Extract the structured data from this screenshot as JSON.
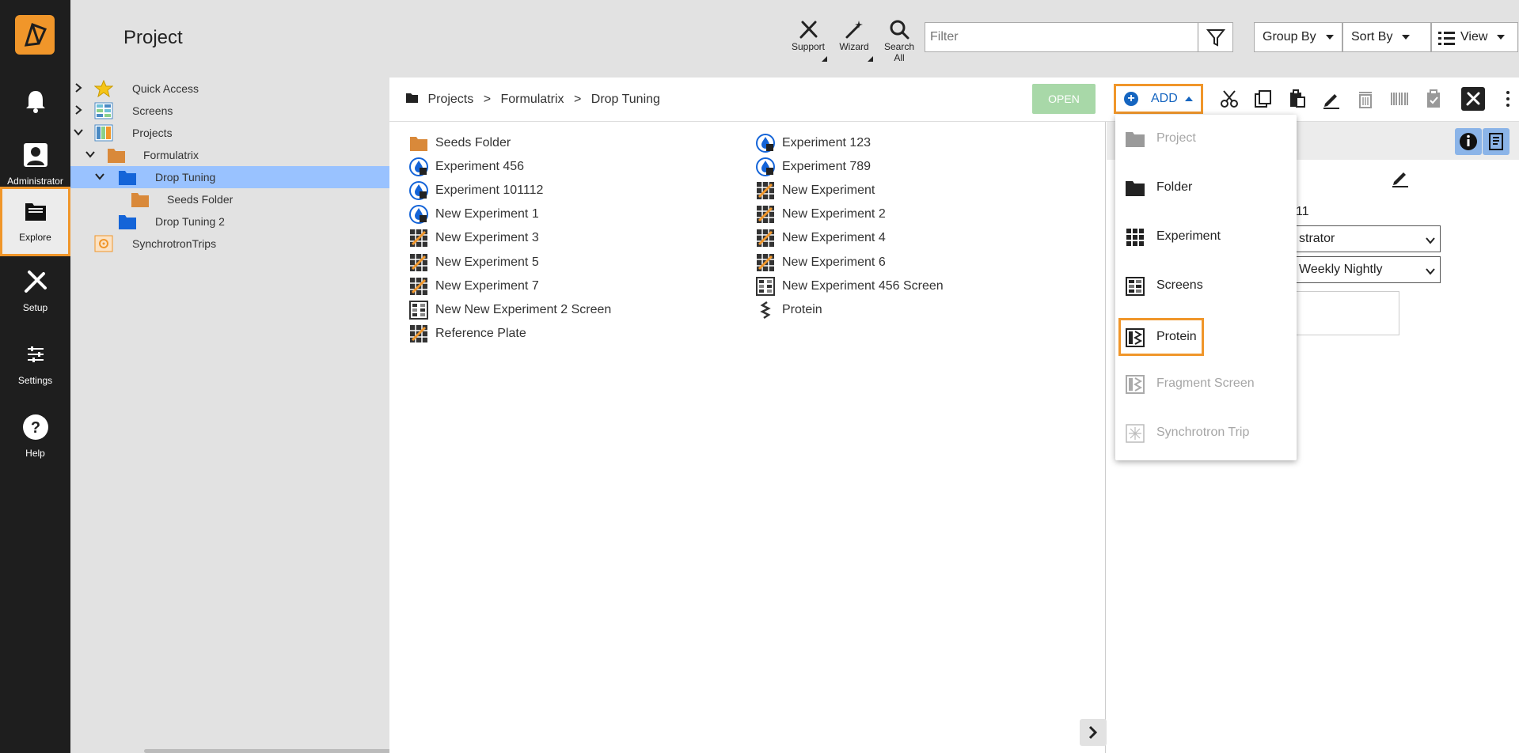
{
  "rail": {
    "items": [
      {
        "label": ""
      },
      {
        "label": "Administrator"
      },
      {
        "label": "Explore"
      },
      {
        "label": "Setup"
      },
      {
        "label": "Settings"
      },
      {
        "label": "Help"
      }
    ]
  },
  "header": {
    "title": "Project",
    "support_label": "Support",
    "wizard_label": "Wizard",
    "search_all_label": "Search All",
    "filter_placeholder": "Filter",
    "group_by_label": "Group By",
    "sort_by_label": "Sort By",
    "view_label": "View"
  },
  "tree": {
    "items": [
      {
        "label": "Quick Access"
      },
      {
        "label": "Screens"
      },
      {
        "label": "Projects"
      },
      {
        "label": "Formulatrix"
      },
      {
        "label": "Drop Tuning"
      },
      {
        "label": "Seeds Folder"
      },
      {
        "label": "Drop Tuning 2"
      },
      {
        "label": "SynchrotronTrips"
      }
    ]
  },
  "breadcrumb": {
    "items": [
      "Projects",
      "Formulatrix",
      "Drop Tuning"
    ],
    "separator": ">"
  },
  "actions": {
    "open_label": "OPEN",
    "add_label": "ADD"
  },
  "items": {
    "left": [
      {
        "label": "Seeds Folder",
        "icon": "folder-icon"
      },
      {
        "label": "Experiment 456",
        "icon": "experiment-drop-icon"
      },
      {
        "label": "Experiment 101112",
        "icon": "experiment-drop-icon"
      },
      {
        "label": "New Experiment 1",
        "icon": "experiment-drop-icon"
      },
      {
        "label": "New Experiment 3",
        "icon": "experiment-plate-icon"
      },
      {
        "label": "New Experiment 5",
        "icon": "experiment-plate-icon"
      },
      {
        "label": "New Experiment 7",
        "icon": "experiment-plate-icon"
      },
      {
        "label": "New New Experiment 2 Screen",
        "icon": "screen-icon"
      },
      {
        "label": "Reference Plate",
        "icon": "experiment-plate-icon"
      }
    ],
    "right": [
      {
        "label": "Experiment 123",
        "icon": "experiment-drop-icon"
      },
      {
        "label": "Experiment 789",
        "icon": "experiment-drop-icon"
      },
      {
        "label": "New Experiment",
        "icon": "experiment-plate-icon"
      },
      {
        "label": "New Experiment 2",
        "icon": "experiment-plate-icon"
      },
      {
        "label": "New Experiment 4",
        "icon": "experiment-plate-icon"
      },
      {
        "label": "New Experiment 6",
        "icon": "experiment-plate-icon"
      },
      {
        "label": "New Experiment 456 Screen",
        "icon": "screen-icon"
      },
      {
        "label": "Protein",
        "icon": "protein-icon"
      }
    ]
  },
  "details": {
    "partial_value": "11",
    "owner_select": "strator",
    "schedule_select": "Weekly Nightly"
  },
  "add_menu": {
    "items": [
      {
        "label": "Project",
        "disabled": true
      },
      {
        "label": "Folder",
        "disabled": false
      },
      {
        "label": "Experiment",
        "disabled": false
      },
      {
        "label": "Screens",
        "disabled": false
      },
      {
        "label": "Protein",
        "disabled": false,
        "highlighted": true
      },
      {
        "label": "Fragment Screen",
        "disabled": true
      },
      {
        "label": "Synchrotron Trip",
        "disabled": true
      }
    ]
  },
  "colors": {
    "accent": "#f0962a",
    "rail_bg": "#1e1e1e",
    "selection": "#99c2ff",
    "add_blue": "#1565c0"
  }
}
